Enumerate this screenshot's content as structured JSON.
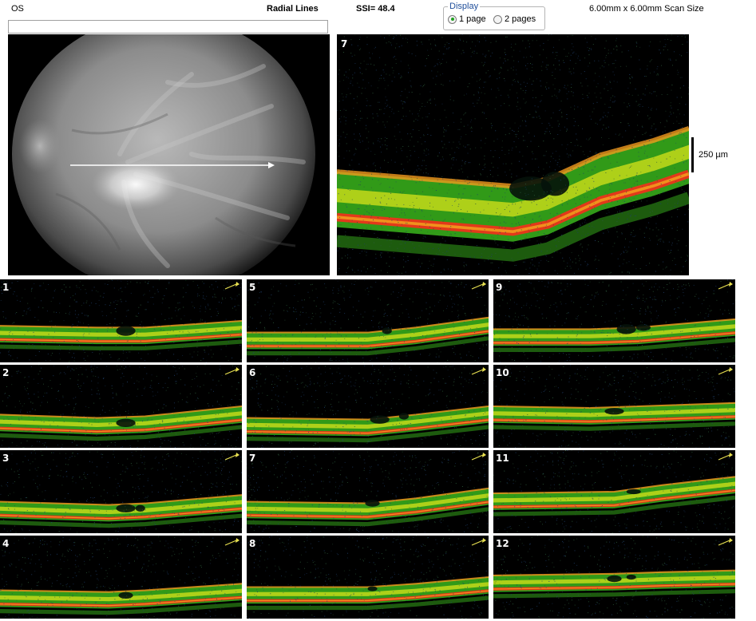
{
  "header": {
    "eye": "OS",
    "scan_type": "Radial Lines",
    "ssi": "SSI= 48.4",
    "scan_size": "6.00mm x 6.00mm Scan Size"
  },
  "display": {
    "legend": "Display",
    "options": [
      {
        "label": "1 page",
        "selected": true
      },
      {
        "label": "2 pages",
        "selected": false
      }
    ]
  },
  "main_scan": {
    "number": "7",
    "scale_label": "250 µm"
  },
  "thumbnails": [
    {
      "number": "1"
    },
    {
      "number": "2"
    },
    {
      "number": "3"
    },
    {
      "number": "4"
    },
    {
      "number": "5"
    },
    {
      "number": "6"
    },
    {
      "number": "7"
    },
    {
      "number": "8"
    },
    {
      "number": "9"
    },
    {
      "number": "10"
    },
    {
      "number": "11"
    },
    {
      "number": "12"
    }
  ],
  "colors": {
    "retina_yellow": "#d8e21a",
    "retina_green": "#39b51c",
    "rpe_red": "#e2391a",
    "rpe_orange": "#f29a1e",
    "background": "#000000",
    "arrow": "#ffffff",
    "orientation_arrow": "#e8e050"
  },
  "icons": {
    "orientation": "arrow-icon"
  }
}
